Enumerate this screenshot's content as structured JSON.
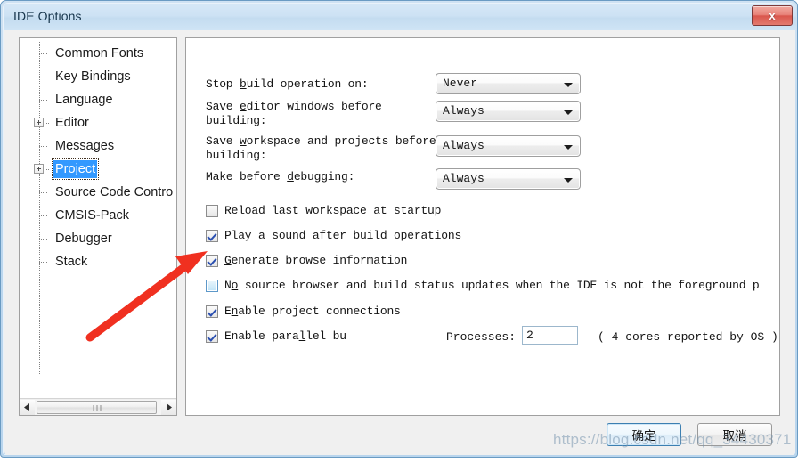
{
  "window": {
    "title": "IDE Options",
    "close_label": "x"
  },
  "sidebar": {
    "items": [
      {
        "label": "Common Fonts",
        "expandable": false,
        "selected": false
      },
      {
        "label": "Key Bindings",
        "expandable": false,
        "selected": false
      },
      {
        "label": "Language",
        "expandable": false,
        "selected": false
      },
      {
        "label": "Editor",
        "expandable": true,
        "selected": false
      },
      {
        "label": "Messages",
        "expandable": false,
        "selected": false
      },
      {
        "label": "Project",
        "expandable": true,
        "selected": true
      },
      {
        "label": "Source Code Contro",
        "expandable": false,
        "selected": false
      },
      {
        "label": "CMSIS-Pack",
        "expandable": false,
        "selected": false
      },
      {
        "label": "Debugger",
        "expandable": false,
        "selected": false
      },
      {
        "label": "Stack",
        "expandable": false,
        "selected": false
      }
    ]
  },
  "main": {
    "fields": [
      {
        "label_pre": "Stop ",
        "label_acc": "b",
        "label_post": "uild operation on:",
        "value": "Never"
      },
      {
        "label_pre": "Save ",
        "label_acc": "e",
        "label_post": "ditor windows before\nbuilding:",
        "value": "Always"
      },
      {
        "label_pre": "Save ",
        "label_acc": "w",
        "label_post": "orkspace and projects before\nbuilding:",
        "value": "Always"
      },
      {
        "label_pre": "Make before ",
        "label_acc": "d",
        "label_post": "ebugging:",
        "value": "Always"
      }
    ],
    "checkboxes": [
      {
        "label_pre": "",
        "label_acc": "R",
        "label_post": "eload last workspace at startup",
        "checked": false,
        "hover": false
      },
      {
        "label_pre": "",
        "label_acc": "P",
        "label_post": "lay a sound after build operations",
        "checked": true,
        "hover": false
      },
      {
        "label_pre": "",
        "label_acc": "G",
        "label_post": "enerate browse information",
        "checked": true,
        "hover": false
      },
      {
        "label_pre": "N",
        "label_acc": "o",
        "label_post": " source browser and build status updates when the IDE is not the foreground p",
        "checked": false,
        "hover": true
      },
      {
        "label_pre": "E",
        "label_acc": "n",
        "label_post": "able project connections",
        "checked": true,
        "hover": false
      },
      {
        "label_pre": "Enable para",
        "label_acc": "l",
        "label_post": "lel bu",
        "checked": true,
        "hover": false
      }
    ],
    "processes": {
      "label": "Processes:",
      "value": "2",
      "note": "( 4 cores reported by OS )"
    }
  },
  "footer": {
    "ok_label": "确定",
    "cancel_label": "取消"
  },
  "watermark": {
    "text": "https://blog.csdn.net/qq_34430371"
  }
}
